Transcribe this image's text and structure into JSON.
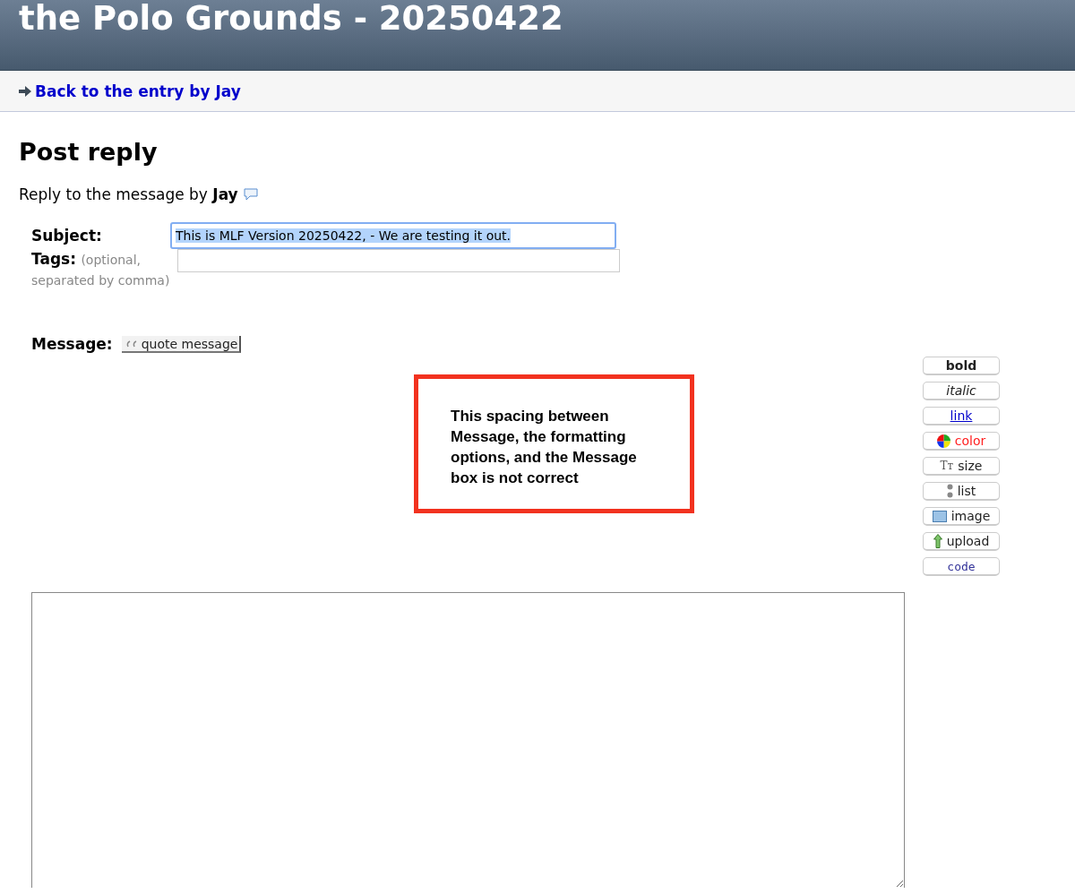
{
  "header": {
    "title": "the Polo Grounds - 20250422"
  },
  "nav": {
    "link": "Back to the entry by Jay"
  },
  "heading": "Post reply",
  "reply_to": {
    "text": "Reply to the message by",
    "author": "Jay"
  },
  "form": {
    "subject": {
      "label": "Subject:",
      "value": "This is MLF Version 20250422, - We are testing it out.",
      "text_selected": true,
      "focused": true
    },
    "tags": {
      "label": "Tags:",
      "hint": "(optional, separated by comma)"
    },
    "message": {
      "label": "Message:",
      "quote_button": "quote message"
    }
  },
  "toolbar": [
    {
      "kind": "bold",
      "label": "bold"
    },
    {
      "kind": "italic",
      "label": "italic"
    },
    {
      "kind": "link",
      "label": "link"
    },
    {
      "kind": "color",
      "label": "color"
    },
    {
      "kind": "size",
      "label": "size",
      "icon_text": "Tт"
    },
    {
      "kind": "list",
      "label": "list"
    },
    {
      "kind": "image",
      "label": "image"
    },
    {
      "kind": "upload",
      "label": "upload"
    },
    {
      "kind": "code",
      "label": "code"
    }
  ],
  "annotation": {
    "text": "This spacing between Message, the formatting options, and the Message box is not correct"
  }
}
